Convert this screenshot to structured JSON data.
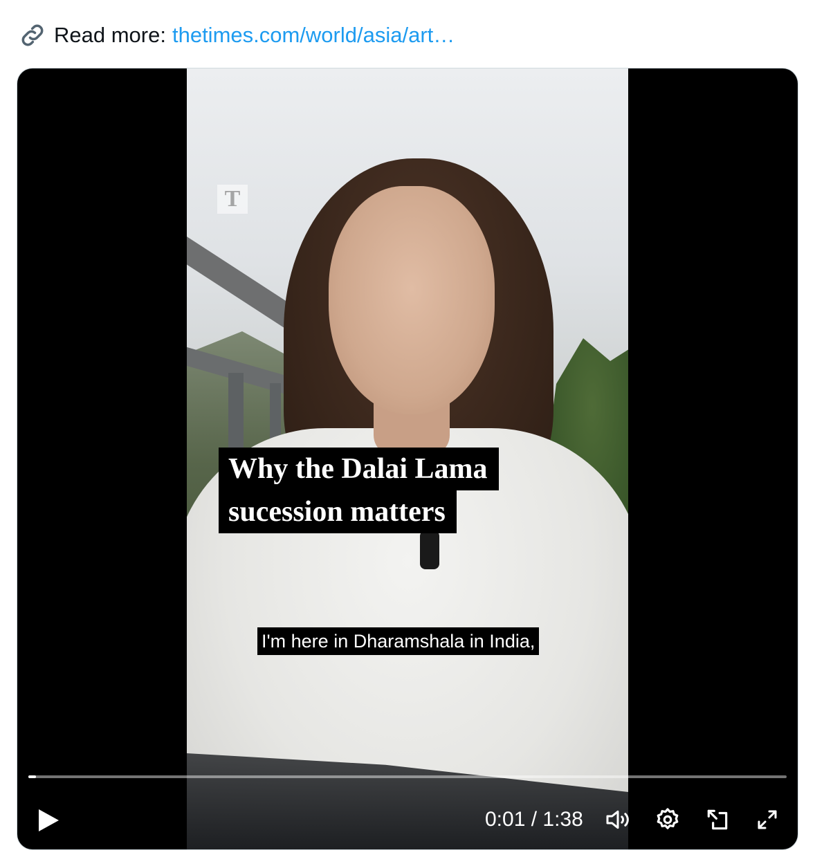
{
  "read_more": {
    "label": "Read more:",
    "url_text": "thetimes.com/world/asia/art…",
    "icon": "link-icon",
    "link_color": "#1d9bf0"
  },
  "video": {
    "logo_text": "T",
    "title_line1": "Why the Dalai Lama",
    "title_line2": "sucession matters",
    "caption": "I'm here in Dharamshala in India,",
    "progress": 0.01,
    "time_display": "0:01 / 1:38",
    "controls": {
      "play_icon": "play-icon",
      "volume_icon": "volume-icon",
      "settings_icon": "gear-icon",
      "pip_icon": "picture-in-picture-icon",
      "fullscreen_icon": "fullscreen-icon"
    }
  }
}
